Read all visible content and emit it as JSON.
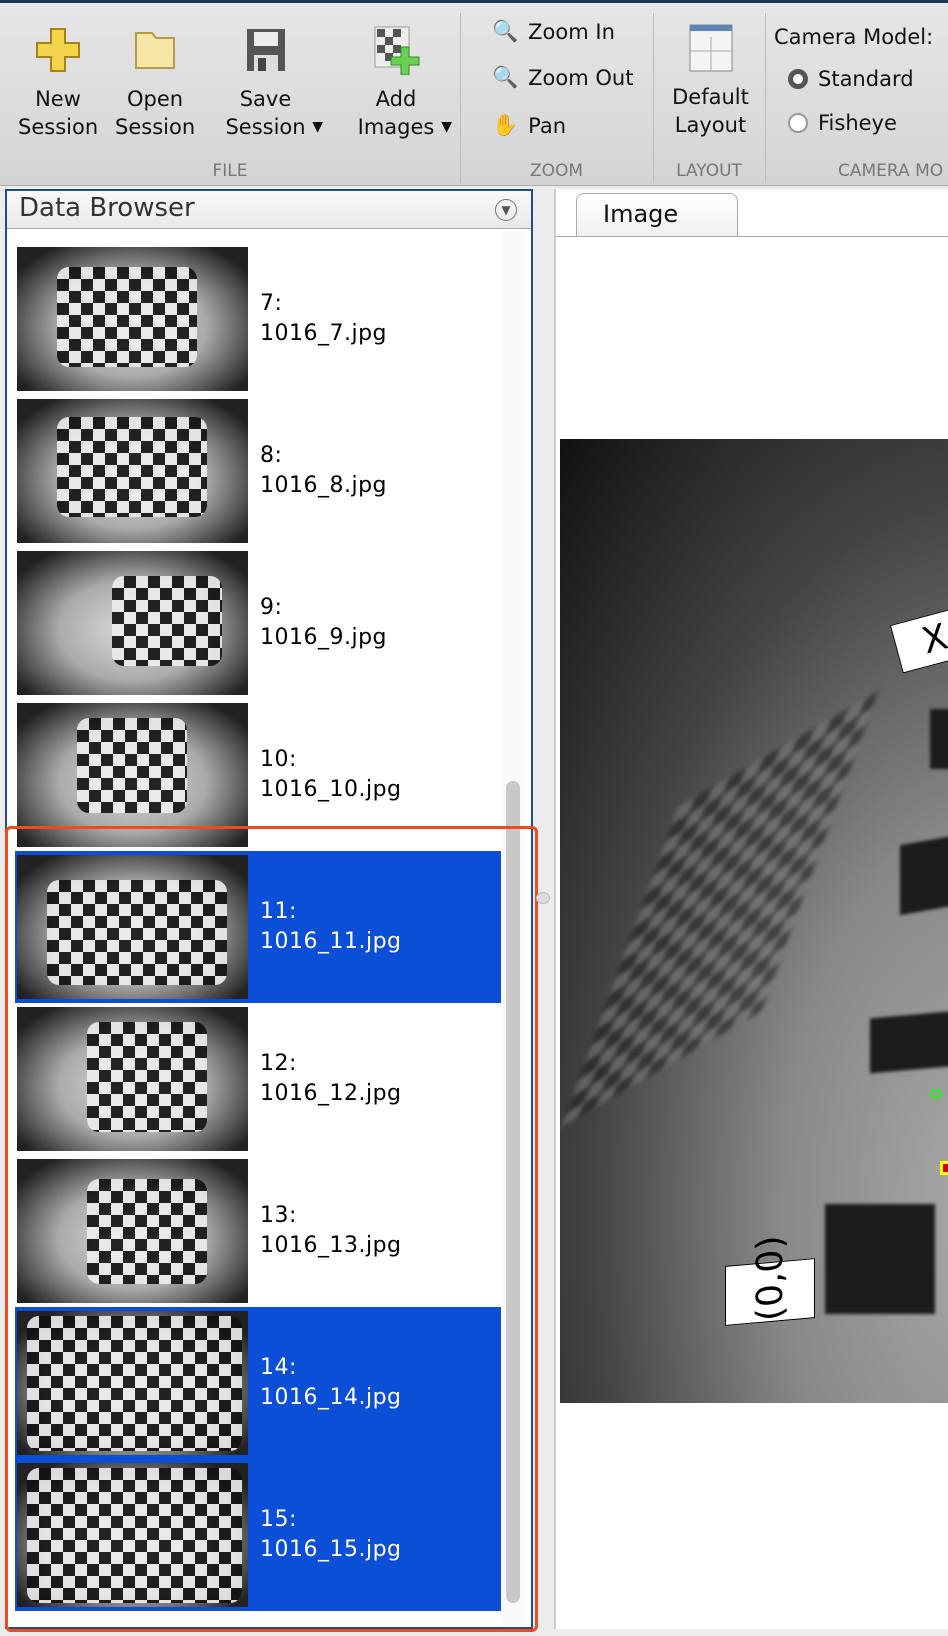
{
  "toolbar": {
    "new_session": "New\nSession",
    "open_session": "Open\nSession",
    "save_session": "Save\nSession",
    "add_images": "Add\nImages",
    "zoom_in": "Zoom In",
    "zoom_out": "Zoom Out",
    "pan": "Pan",
    "default_layout": "Default\nLayout",
    "camera_model_label": "Camera Model:",
    "standard": "Standard",
    "fisheye": "Fisheye",
    "camera_model_selected": "Standard",
    "sections": {
      "file": "FILE",
      "zoom": "ZOOM",
      "layout": "LAYOUT",
      "camera": "CAMERA MO"
    }
  },
  "browser": {
    "title": "Data Browser",
    "items": [
      {
        "index": "7:",
        "file": "1016_7.jpg",
        "selected": false
      },
      {
        "index": "8:",
        "file": "1016_8.jpg",
        "selected": false
      },
      {
        "index": "9:",
        "file": "1016_9.jpg",
        "selected": false
      },
      {
        "index": "10:",
        "file": "1016_10.jpg",
        "selected": false
      },
      {
        "index": "11:",
        "file": "1016_11.jpg",
        "selected": true
      },
      {
        "index": "12:",
        "file": "1016_12.jpg",
        "selected": false
      },
      {
        "index": "13:",
        "file": "1016_13.jpg",
        "selected": false
      },
      {
        "index": "14:",
        "file": "1016_14.jpg",
        "selected": true
      },
      {
        "index": "15:",
        "file": "1016_15.jpg",
        "selected": true
      }
    ]
  },
  "image_panel": {
    "tab": "Image",
    "origin_label": "(0,0)",
    "x_label": "X"
  },
  "colors": {
    "selection": "#0b4fd6",
    "highlight_box": "#f24a1e"
  }
}
